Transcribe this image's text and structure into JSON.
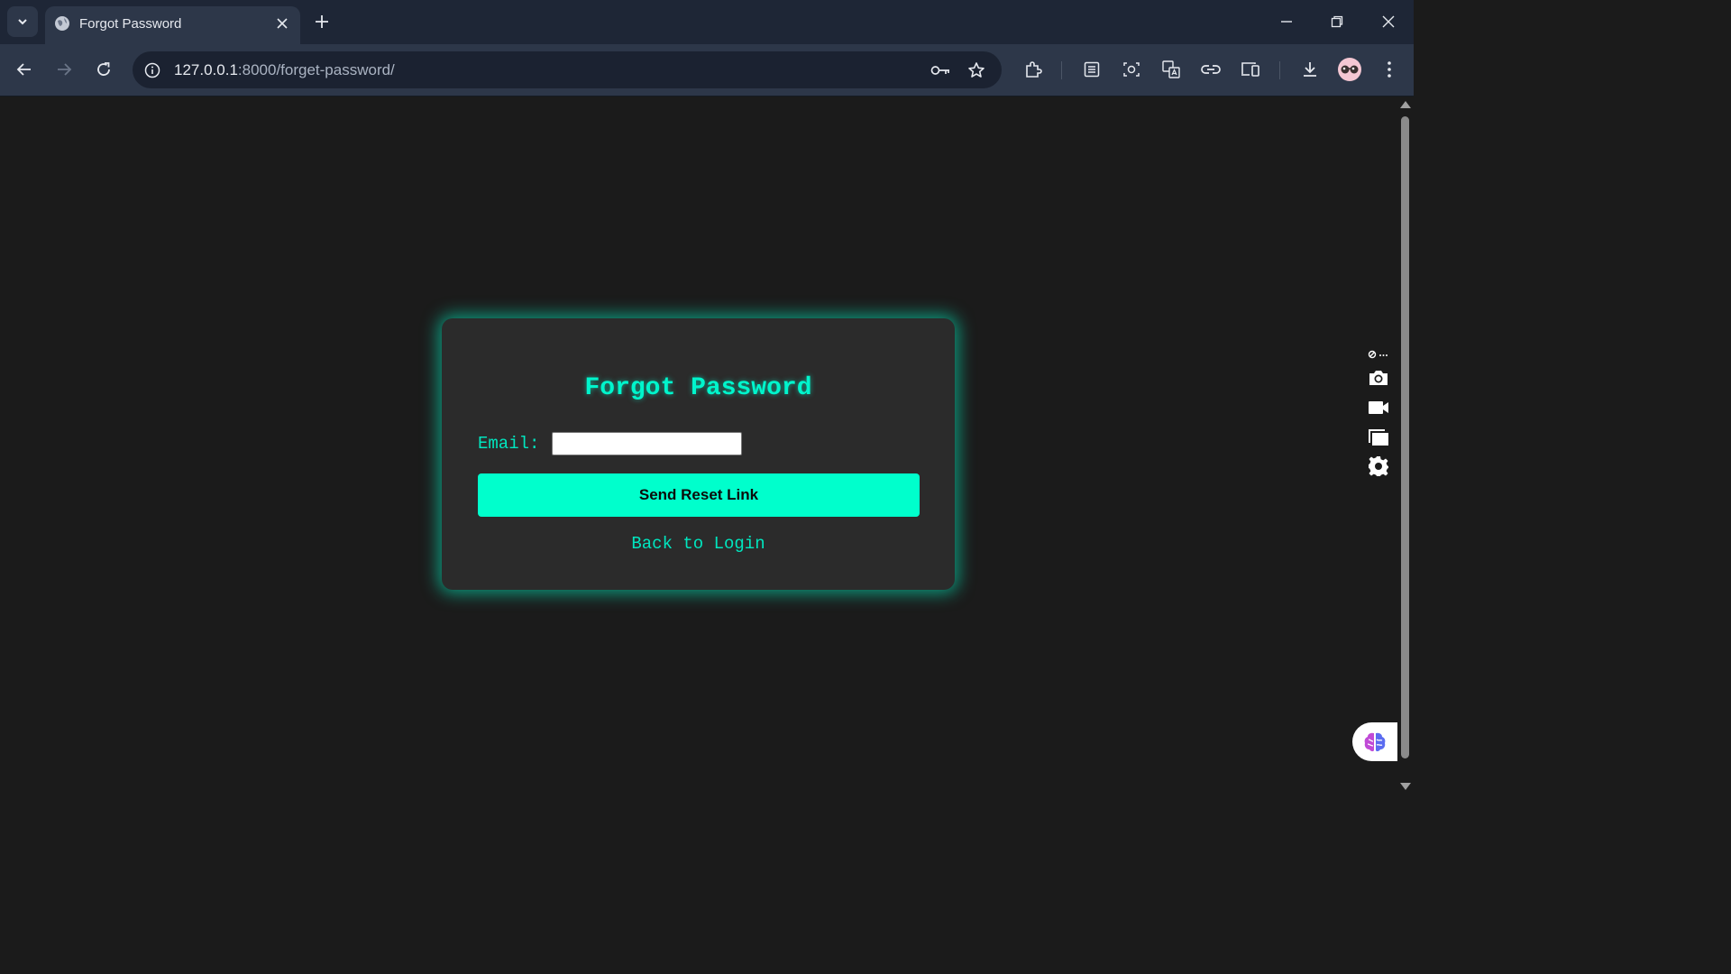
{
  "browser": {
    "tab_title": "Forgot Password",
    "url_host": "127.0.0.1",
    "url_rest": ":8000/forget-password/"
  },
  "icons": {
    "tab_search": "chevron-down-icon",
    "favicon": "globe-icon",
    "tab_close": "close-icon",
    "new_tab": "plus-icon",
    "minimize": "minimize-icon",
    "restore": "restore-icon",
    "close_window": "close-icon",
    "back": "arrow-left-icon",
    "forward": "arrow-right-icon",
    "reload": "reload-icon",
    "site_info": "info-icon",
    "password_key": "key-icon",
    "bookmark": "star-icon",
    "extensions": "puzzle-icon",
    "reading_list": "list-icon",
    "screenshot": "camera-lens-icon",
    "translate": "translate-icon",
    "link": "link-icon",
    "devices": "devices-icon",
    "downloads": "download-icon",
    "profile": "avatar-icon",
    "menu": "kebab-menu-icon",
    "side_camera": "camera-icon",
    "side_video": "video-icon",
    "side_window": "window-icon",
    "side_settings": "gear-icon",
    "assistant": "brain-icon"
  },
  "form": {
    "heading": "Forgot Password",
    "email_label": "Email:",
    "email_value": "",
    "submit_label": "Send Reset Link",
    "back_link": "Back to Login"
  },
  "colors": {
    "accent": "#00ffcc",
    "page_background": "#1b1b1b",
    "card_background": "#2b2b2b",
    "browser_chrome": "#2d3749"
  }
}
